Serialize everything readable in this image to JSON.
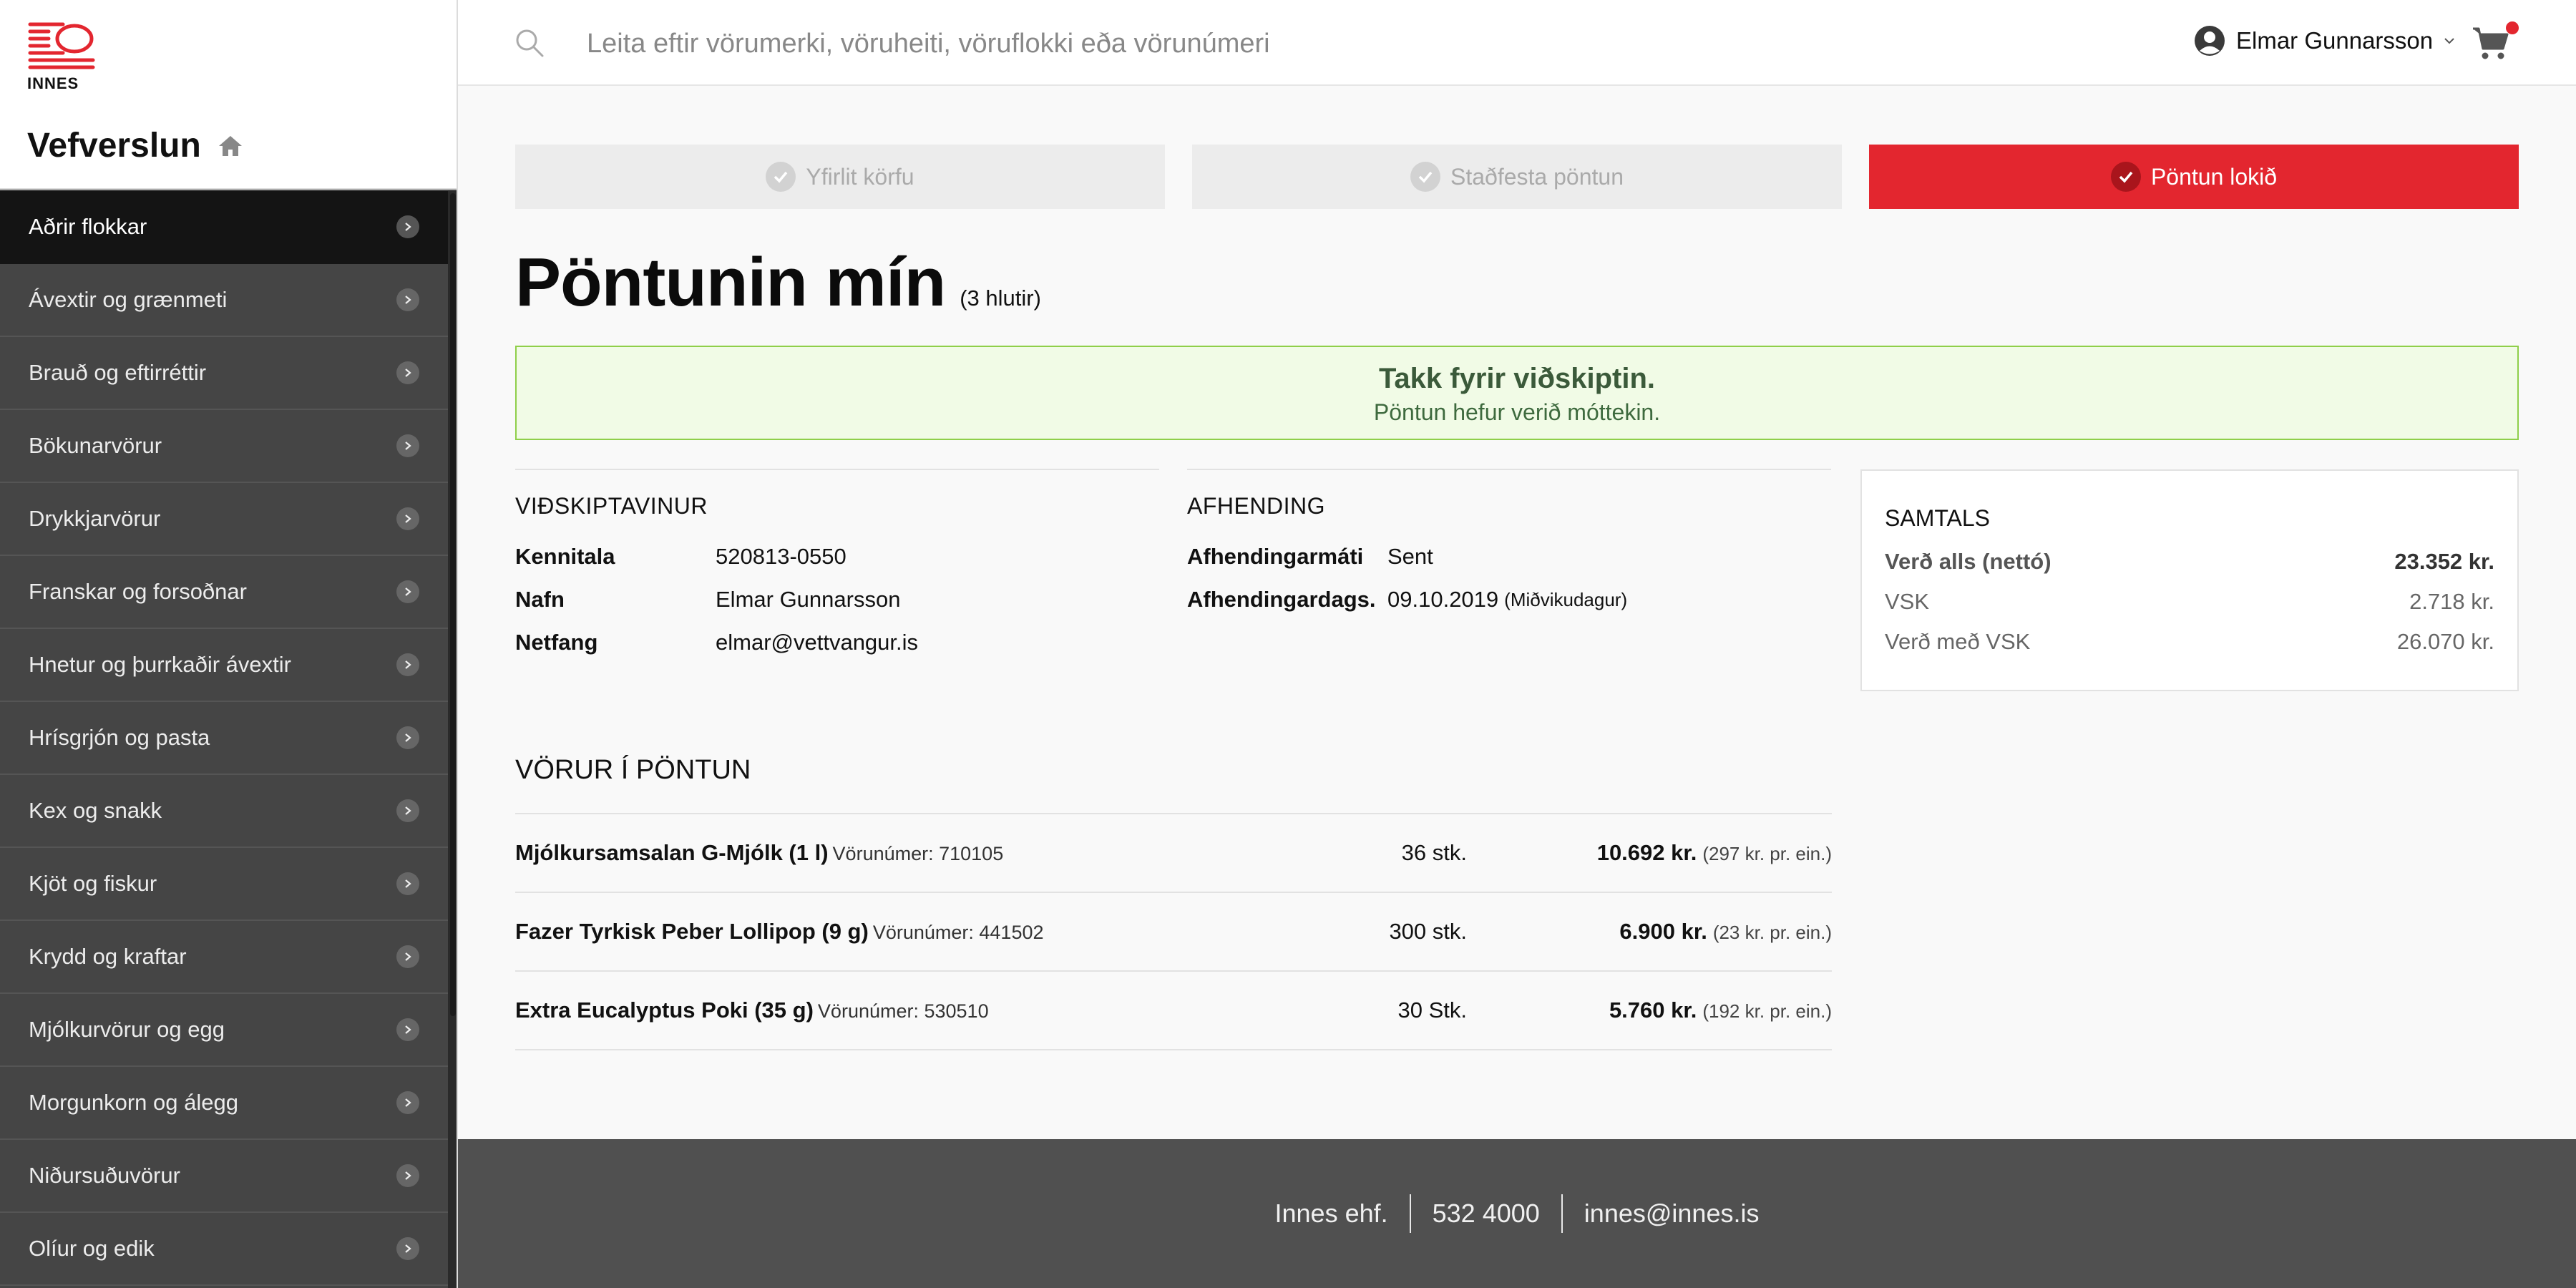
{
  "sidebar": {
    "logo_text": "INNES",
    "store_title": "Vefverslun",
    "categories": [
      {
        "label": "Aðrir flokkar",
        "active": true
      },
      {
        "label": "Ávextir og grænmeti"
      },
      {
        "label": "Brauð og eftirréttir"
      },
      {
        "label": "Bökunarvörur"
      },
      {
        "label": "Drykkjarvörur"
      },
      {
        "label": "Franskar og forsoðnar"
      },
      {
        "label": "Hnetur og þurrkaðir ávextir"
      },
      {
        "label": "Hrísgrjón og pasta"
      },
      {
        "label": "Kex og snakk"
      },
      {
        "label": "Kjöt og fiskur"
      },
      {
        "label": "Krydd og kraftar"
      },
      {
        "label": "Mjólkurvörur og egg"
      },
      {
        "label": "Morgunkorn og álegg"
      },
      {
        "label": "Niðursuðuvörur"
      },
      {
        "label": "Olíur og edik"
      }
    ]
  },
  "header": {
    "search_placeholder": "Leita eftir vörumerki, vöruheiti, vöruflokki eða vörunúmeri",
    "user_name": "Elmar Gunnarsson",
    "cart_icon": "cart-icon"
  },
  "steps": [
    {
      "label": "Yfirlit körfu",
      "state": "done"
    },
    {
      "label": "Staðfesta pöntun",
      "state": "done"
    },
    {
      "label": "Pöntun lokið",
      "state": "current"
    }
  ],
  "page": {
    "title": "Pöntunin mín",
    "item_count": "(3 hlutir)"
  },
  "success": {
    "title": "Takk fyrir viðskiptin.",
    "subtitle": "Pöntun hefur verið móttekin."
  },
  "customer": {
    "title": "VIÐSKIPTAVINUR",
    "rows": [
      {
        "label": "Kennitala",
        "value": "520813-0550"
      },
      {
        "label": "Nafn",
        "value": "Elmar Gunnarsson"
      },
      {
        "label": "Netfang",
        "value": "elmar@vettvangur.is"
      }
    ]
  },
  "delivery": {
    "title": "AFHENDING",
    "method_label": "Afhendingarmáti",
    "method_value": "Sent",
    "date_label": "Afhendingardags.",
    "date_value": "09.10.2019",
    "date_day": "(Miðvikudagur)"
  },
  "totals": {
    "title": "SAMTALS",
    "net_label": "Verð alls (nettó)",
    "net_value": "23.352 kr.",
    "vat_label": "VSK",
    "vat_value": "2.718 kr.",
    "gross_label": "Verð með VSK",
    "gross_value": "26.070 kr."
  },
  "order_lines": {
    "title": "VÖRUR Í PÖNTUN",
    "items": [
      {
        "name": "Mjólkursamsalan G-Mjólk (1 l)",
        "sku": "Vörunúmer: 710105",
        "qty": "36 stk.",
        "price": "10.692 kr.",
        "unit_price": "(297 kr. pr. ein.)"
      },
      {
        "name": "Fazer Tyrkisk Peber Lollipop (9 g)",
        "sku": "Vörunúmer: 441502",
        "qty": "300 stk.",
        "price": "6.900 kr.",
        "unit_price": "(23 kr. pr. ein.)"
      },
      {
        "name": "Extra Eucalyptus Poki (35 g)",
        "sku": "Vörunúmer: 530510",
        "qty": "30 Stk.",
        "price": "5.760 kr.",
        "unit_price": "(192 kr. pr. ein.)"
      }
    ]
  },
  "footer": {
    "company": "Innes ehf.",
    "phone": "532 4000",
    "email": "innes@innes.is"
  },
  "colors": {
    "accent": "#e3262f",
    "sidebar_bg": "#454545",
    "success_border": "#8fcf4a",
    "footer_bg": "#505050"
  }
}
